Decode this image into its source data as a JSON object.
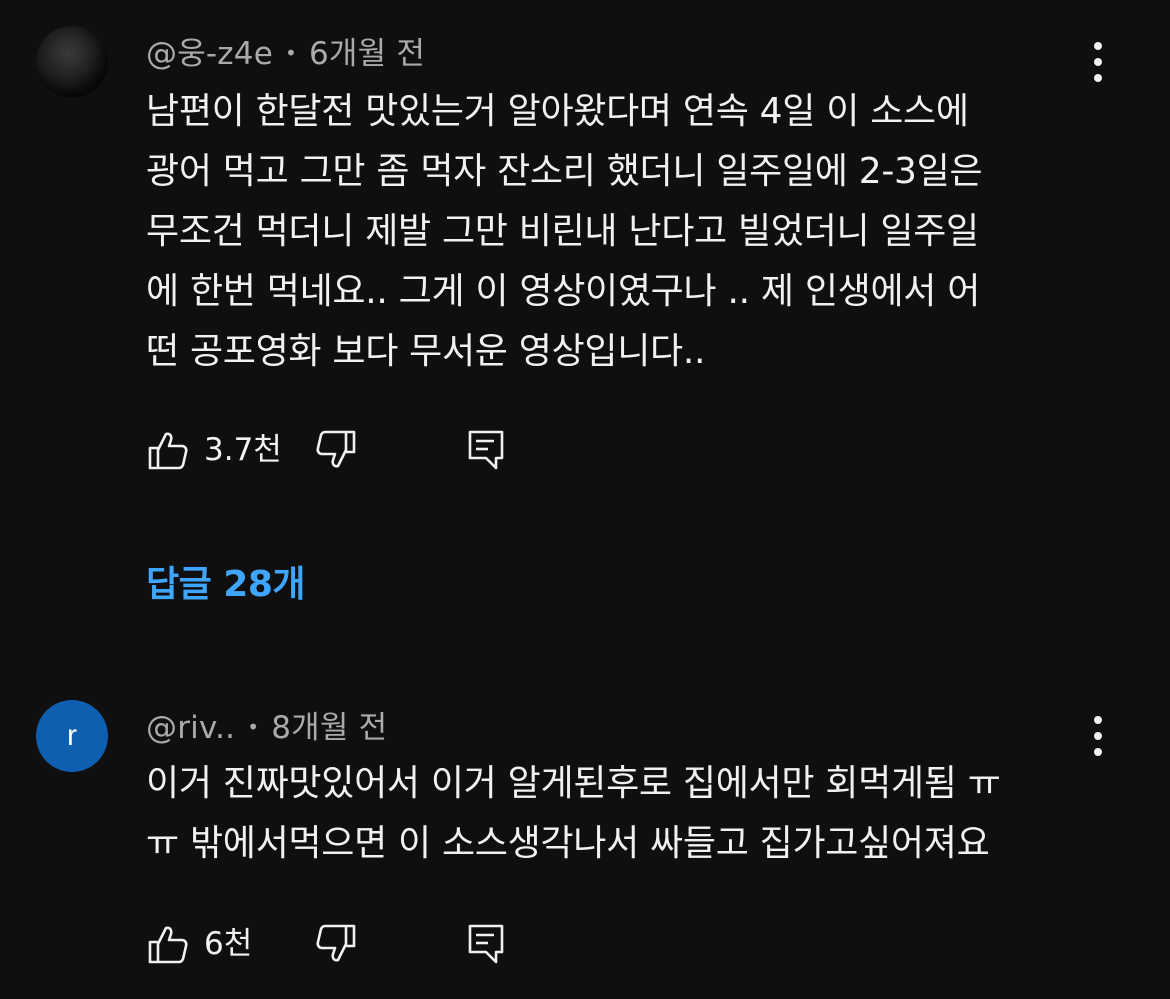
{
  "comments": [
    {
      "author": "@웅-z4e",
      "separator": "•",
      "time": "6개월 전",
      "avatar_kind": "photo",
      "text": "남편이 한달전 맛있는거 알아왔다며 연속 4일 이 소스에\n광어 먹고 그만 좀 먹자 잔소리 했더니 일주일에 2-3일은\n무조건 먹더니 제발 그만 비린내 난다고 빌었더니 일주일\n에 한번 먹네요.. 그게 이 영상이였구나 .. 제 인생에서 어\n떤 공포영화 보다 무서운 영상입니다..",
      "likes": "3.7천",
      "replies_label": "답글 28개"
    },
    {
      "author": "@riv..",
      "separator": "•",
      "time": "8개월 전",
      "avatar_kind": "letter",
      "avatar_letter": "r",
      "avatar_color": "#0f5fb0",
      "text": "이거 진짜맛있어서 이거 알게된후로 집에서만 회먹게됨 ㅠ\nㅠ 밖에서먹으면 이 소스생각나서 싸들고 집가고싶어져요",
      "likes": "6천"
    }
  ],
  "icons": {
    "like": "thumb-up-icon",
    "dislike": "thumb-down-icon",
    "reply": "reply-comment-icon",
    "more": "more-vertical-icon"
  },
  "colors": {
    "background": "#0f0f0f",
    "text": "#f1f1f1",
    "meta": "#aaaaaa",
    "link": "#3ea6ff"
  }
}
